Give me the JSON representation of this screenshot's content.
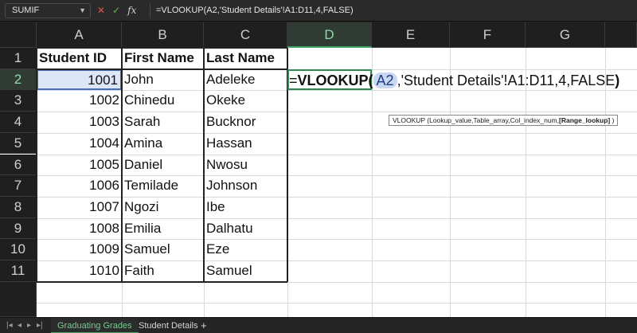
{
  "formula_bar": {
    "name_box": "SUMIF",
    "formula": "=VLOOKUP(A2,'Student Details'!A1:D11,4,FALSE)"
  },
  "columns": [
    "A",
    "B",
    "C",
    "D",
    "E",
    "F",
    "G"
  ],
  "rows": [
    "1",
    "2",
    "3",
    "4",
    "5",
    "6",
    "7",
    "8",
    "9",
    "10",
    "11"
  ],
  "table": {
    "headers": [
      "Student ID",
      "First Name",
      "Last Name"
    ],
    "rows": [
      [
        "1001",
        "John",
        "Adeleke"
      ],
      [
        "1002",
        "Chinedu",
        "Okeke"
      ],
      [
        "1003",
        "Sarah",
        "Bucknor"
      ],
      [
        "1004",
        "Amina",
        "Hassan"
      ],
      [
        "1005",
        "Daniel",
        "Nwosu"
      ],
      [
        "1006",
        "Temilade",
        "Johnson"
      ],
      [
        "1007",
        "Ngozi",
        "Ibe"
      ],
      [
        "1008",
        "Emilia",
        "Dalhatu"
      ],
      [
        "1009",
        "Samuel",
        "Eze"
      ],
      [
        "1010",
        "Faith",
        "Samuel"
      ]
    ]
  },
  "edit": {
    "prefix": "=",
    "fn": "VLOOKUP",
    "open": "(",
    "ref": "A2",
    "rest": ",'Student Details'!A1:D11,4,FALSE",
    "close": ")"
  },
  "tooltip": {
    "text": "VLOOKUP (Lookup_value,Table_array,Col_index_num,",
    "optional": "[Range_lookup]",
    "close": " )"
  },
  "sheets": {
    "active": "Graduating Grades",
    "other": "Student Details",
    "add": "+"
  },
  "colors": {
    "active_tab": "#6fcf8c",
    "selection": "#dce6f7",
    "active_cell_border": "#2f8a4e"
  }
}
